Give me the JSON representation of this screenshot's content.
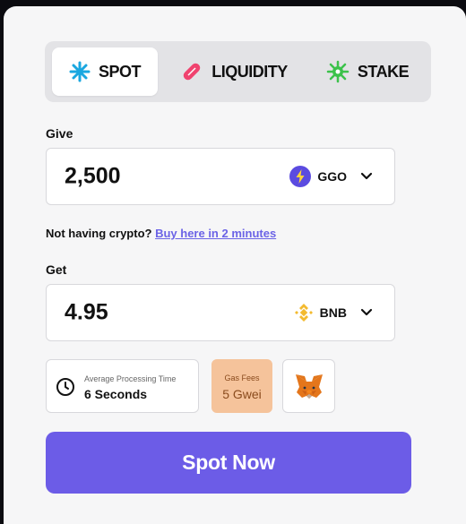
{
  "tabs": [
    {
      "label": "SPOT",
      "icon": "sparkle-icon",
      "color": "#1aa7e0",
      "active": true
    },
    {
      "label": "LIQUIDITY",
      "icon": "capsule-icon",
      "color": "#f0436f",
      "active": false
    },
    {
      "label": "STAKE",
      "icon": "virus-icon",
      "color": "#3cc24b",
      "active": false
    }
  ],
  "give": {
    "label": "Give",
    "amount": "2,500",
    "token": "GGO",
    "token_icon": "bolt-icon",
    "token_color": "#5b4be0"
  },
  "buy": {
    "text": "Not having crypto?",
    "link": "Buy here in 2 minutes"
  },
  "get": {
    "label": "Get",
    "amount": "4.95",
    "token": "BNB",
    "token_icon": "bnb-icon",
    "token_color": "#f3ba2f"
  },
  "processing": {
    "caption": "Average Processing Time",
    "value": "6 Seconds"
  },
  "gas": {
    "caption": "Gas Fees",
    "value": "5 Gwei"
  },
  "wallet": {
    "icon": "metamask-fox-icon"
  },
  "cta": {
    "label": "Spot Now",
    "color": "#6c5ce7"
  }
}
